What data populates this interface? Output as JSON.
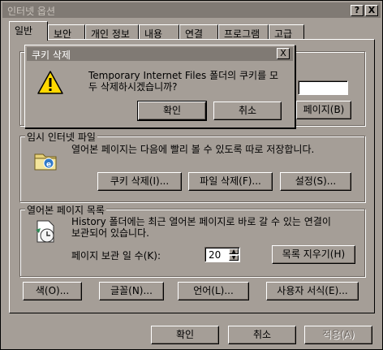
{
  "window": {
    "title": "인터넷 옵션",
    "help_btn": "?",
    "close_btn": "X"
  },
  "tabs": [
    "일반",
    "보안",
    "개인 정보",
    "내용",
    "연결",
    "프로그램",
    "고급"
  ],
  "homepage": {
    "use_blank_label": "페이지(B)"
  },
  "temp_files": {
    "group_label": "임시 인터넷 파일",
    "desc": "열어본 페이지는 다음에 빨리 볼 수 있도록 따로 저장합니다.",
    "delete_cookies": "쿠키 삭제(I)...",
    "delete_files": "파일 삭제(F)...",
    "settings": "설정(S)..."
  },
  "history": {
    "group_label": "열어본 페이지 목록",
    "desc_line1": "History 폴더에는 최근 열어본 페이지로 바로 갈 수 있는 연결이",
    "desc_line2": "보관되어 있습니다.",
    "days_label": "페이지 보관 일 수(K):",
    "days_value": "20",
    "clear": "목록 지우기(H)"
  },
  "bottom_buttons": {
    "colors": "색(O)...",
    "fonts": "글꼴(N)...",
    "languages": "언어(L)...",
    "accessibility": "사용자 서식(E)..."
  },
  "footer": {
    "ok": "확인",
    "cancel": "취소",
    "apply": "적용(A)"
  },
  "dialog": {
    "title": "쿠키 삭제",
    "close": "X",
    "message_line1": "Temporary Internet Files 폴더의 쿠키를 모",
    "message_line2": "두 삭제하시겠습니까?",
    "ok": "확인",
    "cancel": "취소",
    "icon": "warning-icon"
  }
}
